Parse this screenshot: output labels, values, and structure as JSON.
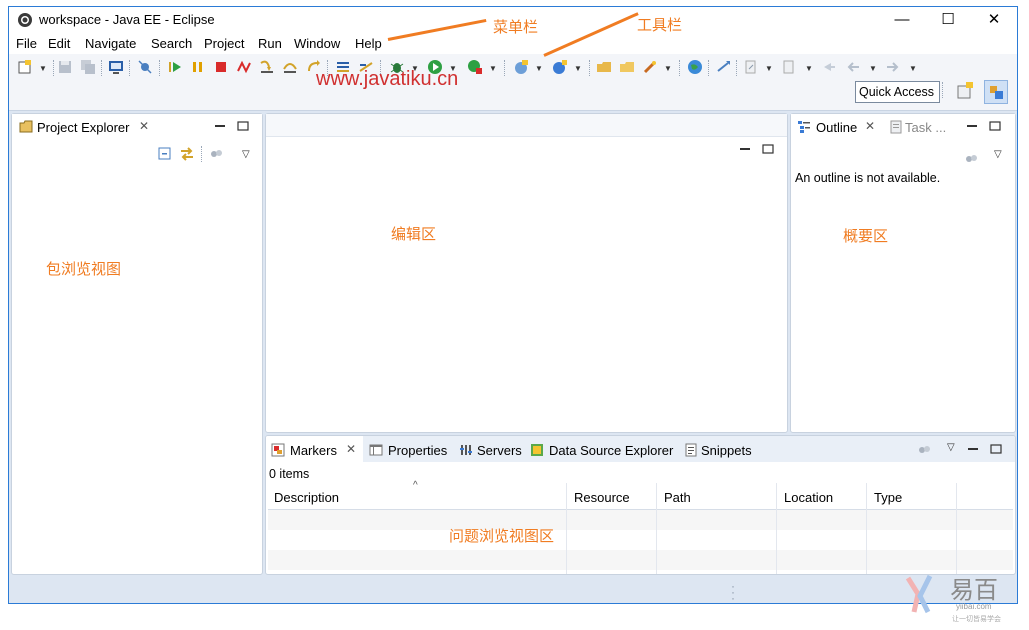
{
  "window": {
    "title": "workspace - Java EE - Eclipse",
    "minimize": "—",
    "maximize": "☐",
    "close": "✕"
  },
  "menu": [
    "File",
    "Edit",
    "Navigate",
    "Search",
    "Project",
    "Run",
    "Window",
    "Help"
  ],
  "toolbar": {
    "quick_access": "Quick Access"
  },
  "watermark": "www.javatiku.cn",
  "annotations": {
    "menubar": "菜单栏",
    "toolbar": "工具栏",
    "package_view": "包浏览视图",
    "editor": "编辑区",
    "outline": "概要区",
    "problems": "问题浏览视图区"
  },
  "project_explorer": {
    "tab": "Project Explorer"
  },
  "outline": {
    "tab": "Outline",
    "tab2": "Task ...",
    "message": "An outline is not available."
  },
  "bottom": {
    "tabs": [
      "Markers",
      "Properties",
      "Servers",
      "Data Source Explorer",
      "Snippets"
    ],
    "items_count": "0 items",
    "columns": [
      "Description",
      "Resource",
      "Path",
      "Location",
      "Type"
    ]
  },
  "logo": {
    "text": "易百",
    "sub": "yiibai.com",
    "tagline": "让一切皆易学会"
  },
  "colors": {
    "accent": "#2b7bd6",
    "annotation": "#f07c22",
    "watermark": "#d03030"
  }
}
